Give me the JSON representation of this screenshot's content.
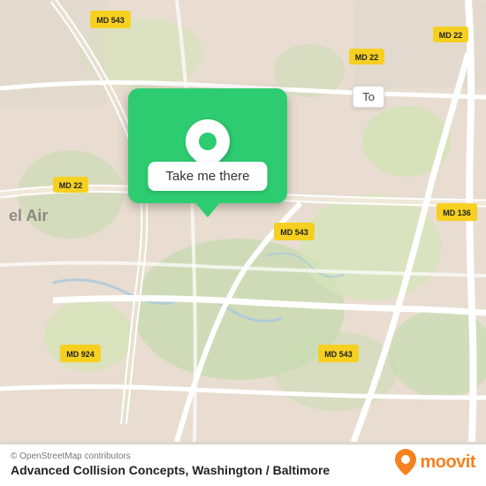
{
  "map": {
    "attribution": "© OpenStreetMap contributors",
    "background_color": "#e8e0d8",
    "center": "Advanced Collision Concepts area, Maryland"
  },
  "popup": {
    "button_label": "Take me there",
    "button_color": "#ffffff",
    "card_color": "#2ecc71"
  },
  "to_label": {
    "text": "To"
  },
  "bottom_bar": {
    "copyright": "© OpenStreetMap contributors",
    "location_name": "Advanced Collision Concepts, Washington / Baltimore"
  },
  "moovit": {
    "text": "moovit"
  },
  "road_labels": [
    "MD 543",
    "MD 22",
    "MD 136",
    "MD 924",
    "MD 543"
  ]
}
